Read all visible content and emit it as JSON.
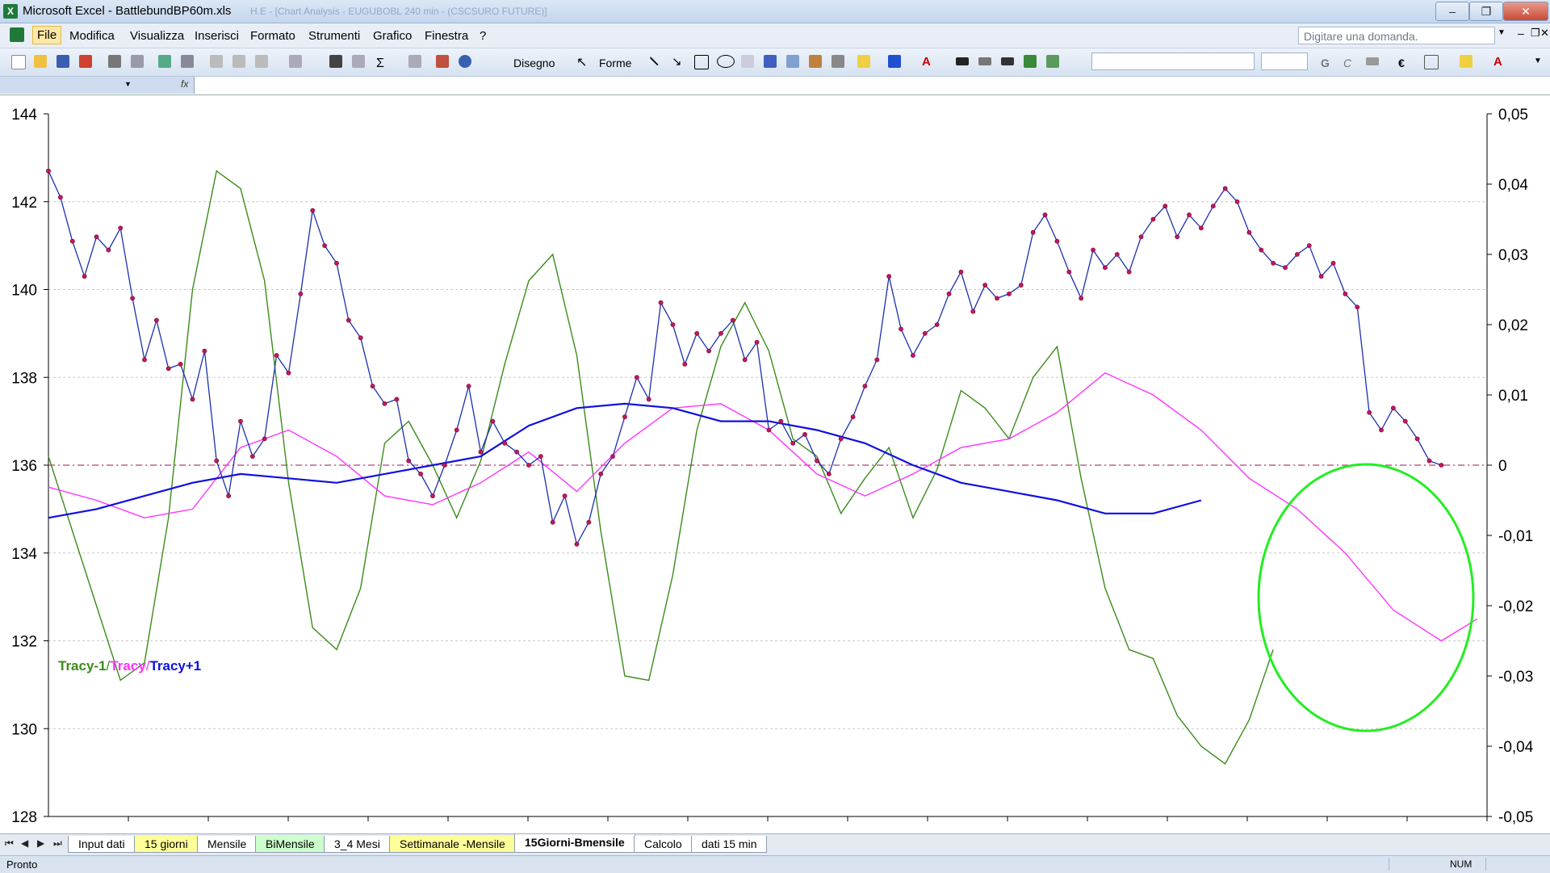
{
  "window": {
    "title": "Microsoft Excel - BattlebundBP60m.xls",
    "ghost_title": "H.E - [Chart Analysis - EUGUBOBL 240 min - (CSCSURO FUTURE)]"
  },
  "menu": {
    "items": [
      "File",
      "Modifica",
      "Visualizza",
      "Inserisci",
      "Formato",
      "Strumenti",
      "Grafico",
      "Finestra",
      "?"
    ],
    "help_placeholder": "Digitare una domanda."
  },
  "toolbar": {
    "draw_label": "Disegno",
    "shapes_label": "Forme",
    "bold_label": "G",
    "italic_label": "C",
    "currency_label": "€"
  },
  "formula_bar": {
    "fx_label": "fx"
  },
  "colors": {
    "price_line": "#1c2fb0",
    "price_marker": "#c2185b",
    "tracy_minus_1": "#3a8c1a",
    "tracy": "#ff33ff",
    "tracy_plus_1": "#1010e0",
    "zero_line": "#b0407a",
    "highlight_circle": "#22ee22"
  },
  "chart_data": {
    "type": "line",
    "y_left": {
      "ticks": [
        "144",
        "142",
        "140",
        "138",
        "136",
        "134",
        "132",
        "130",
        "128"
      ],
      "range": [
        128,
        144
      ]
    },
    "y_right": {
      "ticks": [
        "0,05",
        "0,04",
        "0,03",
        "0,02",
        "0,01",
        "0",
        "-0,01",
        "-0,02",
        "-0,03",
        "-0,04",
        "-0,05"
      ],
      "range": [
        -0.05,
        0.05
      ]
    },
    "grid": true,
    "legend": {
      "items": [
        "Tracy-1",
        "Tracy",
        "Tracy+1"
      ],
      "separator": " / ",
      "placement": "left"
    },
    "price_series": {
      "x": [
        0,
        15,
        30,
        45,
        60,
        75,
        90,
        105,
        120,
        135,
        150,
        165,
        180,
        195,
        210,
        225,
        240,
        255,
        270,
        285,
        300,
        315,
        330,
        345,
        360,
        375,
        390,
        405,
        420,
        435,
        450,
        465,
        480,
        495,
        510,
        525,
        540,
        555,
        570,
        585,
        600,
        615,
        630,
        645,
        660,
        675,
        690,
        705,
        720,
        735,
        750,
        765,
        780,
        795,
        810,
        825,
        840,
        855,
        870,
        885,
        900,
        915,
        930,
        945,
        960,
        975,
        990,
        1005,
        1020,
        1035,
        1050,
        1065,
        1080,
        1095,
        1110,
        1125,
        1140,
        1155,
        1170,
        1185,
        1200,
        1215,
        1230,
        1245,
        1260,
        1275,
        1290,
        1305,
        1320,
        1335,
        1350,
        1365,
        1380,
        1395,
        1410,
        1425,
        1440,
        1455,
        1470,
        1485,
        1500,
        1515,
        1530,
        1545,
        1560,
        1575,
        1590,
        1605,
        1620,
        1635,
        1650,
        1665,
        1680,
        1695,
        1710,
        1725,
        1740,
        1755,
        1770,
        1785
      ],
      "values": [
        142.7,
        142.1,
        141.1,
        140.3,
        141.2,
        140.9,
        141.4,
        139.8,
        138.4,
        139.3,
        138.2,
        138.3,
        137.5,
        138.6,
        136.1,
        135.3,
        137.0,
        136.2,
        136.6,
        138.5,
        138.1,
        139.9,
        141.8,
        141.0,
        140.6,
        139.3,
        138.9,
        137.8,
        137.4,
        137.5,
        136.1,
        135.8,
        135.3,
        136.0,
        136.8,
        137.8,
        136.3,
        137.0,
        136.5,
        136.3,
        136.0,
        136.2,
        134.7,
        135.3,
        134.2,
        134.7,
        135.8,
        136.2,
        137.1,
        138.0,
        137.5,
        139.7,
        139.2,
        138.3,
        139.0,
        138.6,
        139.0,
        139.3,
        138.4,
        138.8,
        136.8,
        137.0,
        136.5,
        136.7,
        136.1,
        135.8,
        136.6,
        137.1,
        137.8,
        138.4,
        140.3,
        139.1,
        138.5,
        139.0,
        139.2,
        139.9,
        140.4,
        139.5,
        140.1,
        139.8,
        139.9,
        140.1,
        141.3,
        141.7,
        141.1,
        140.4,
        139.8,
        140.9,
        140.5,
        140.8,
        140.4,
        141.2,
        141.6,
        141.9,
        141.2,
        141.7,
        141.4,
        141.9,
        142.3,
        142.0,
        141.3,
        140.9,
        140.6,
        140.5,
        140.8,
        141.0,
        140.3,
        140.6,
        139.9,
        139.6,
        137.2,
        136.8,
        137.3,
        137.0,
        136.6,
        136.1,
        136.0
      ]
    },
    "tracy_minus_1": {
      "x": [
        0,
        30,
        60,
        90,
        120,
        150,
        180,
        210,
        240,
        270,
        300,
        330,
        360,
        390,
        420,
        450,
        480,
        510,
        540,
        570,
        600,
        630,
        660,
        690,
        720,
        750,
        780,
        810,
        840,
        870,
        900,
        930,
        960,
        990,
        1020,
        1050,
        1080,
        1110,
        1140,
        1170,
        1200,
        1230,
        1260,
        1290,
        1320,
        1350,
        1380,
        1410,
        1440,
        1470,
        1500,
        1530,
        1560,
        1590,
        1620,
        1650,
        1680,
        1710,
        1740,
        1785
      ],
      "values": [
        136.2,
        134.5,
        132.8,
        131.1,
        131.5,
        134.8,
        140.0,
        142.7,
        142.3,
        140.2,
        135.6,
        132.3,
        131.8,
        133.2,
        136.5,
        137.0,
        136.0,
        134.8,
        136.1,
        138.3,
        140.2,
        140.8,
        138.5,
        134.5,
        131.2,
        131.1,
        133.5,
        136.8,
        138.7,
        139.7,
        138.6,
        136.6,
        136.2,
        134.9,
        135.7,
        136.4,
        134.8,
        135.9,
        137.7,
        137.3,
        136.6,
        138.0,
        138.7,
        135.7,
        133.2,
        131.8,
        131.6,
        130.3,
        129.6,
        129.2,
        130.2,
        131.8
      ]
    },
    "tracy": {
      "x": [
        0,
        60,
        120,
        180,
        240,
        300,
        360,
        420,
        480,
        540,
        600,
        660,
        720,
        780,
        840,
        900,
        960,
        1020,
        1080,
        1140,
        1200,
        1260,
        1320,
        1380,
        1440,
        1500,
        1560,
        1620,
        1680,
        1740,
        1785
      ],
      "values": [
        135.5,
        135.2,
        134.8,
        135.0,
        136.4,
        136.8,
        136.2,
        135.3,
        135.1,
        135.6,
        136.3,
        135.4,
        136.5,
        137.3,
        137.4,
        136.8,
        135.8,
        135.3,
        135.8,
        136.4,
        136.6,
        137.2,
        138.1,
        137.6,
        136.8,
        135.7,
        135.0,
        134.0,
        132.7,
        132.0,
        132.5
      ]
    },
    "tracy_plus_1": {
      "x": [
        0,
        60,
        120,
        180,
        240,
        300,
        360,
        420,
        480,
        540,
        600,
        660,
        720,
        780,
        840,
        900,
        960,
        1020,
        1080,
        1140,
        1200,
        1260,
        1320,
        1380,
        1440,
        1500,
        1560,
        1620,
        1680,
        1740,
        1785
      ],
      "values": [
        134.8,
        135.0,
        135.3,
        135.6,
        135.8,
        135.7,
        135.6,
        135.8,
        136.0,
        136.2,
        136.9,
        137.3,
        137.4,
        137.3,
        137.0,
        137.0,
        136.8,
        136.5,
        136.0,
        135.6,
        135.4,
        135.2,
        134.9,
        134.9,
        135.2
      ]
    },
    "zero_line": 0
  },
  "sheet_tabs": [
    {
      "label": "Input dati",
      "color": "#ffffff"
    },
    {
      "label": "15 giorni",
      "color": "#ffff99"
    },
    {
      "label": "Mensile",
      "color": "#ffffff"
    },
    {
      "label": "BiMensile",
      "color": "#ccffcc"
    },
    {
      "label": "3_4 Mesi",
      "color": "#ffffff"
    },
    {
      "label": "Settimanale -Mensile",
      "color": "#ffff99"
    },
    {
      "label": "15Giorni-Bmensile",
      "color": "#ffffff",
      "active": true
    },
    {
      "label": "Calcolo",
      "color": "#ffffff"
    },
    {
      "label": "dati 15 min",
      "color": "#ffffff"
    }
  ],
  "status": {
    "text": "Pronto",
    "num_indicator": "NUM"
  }
}
